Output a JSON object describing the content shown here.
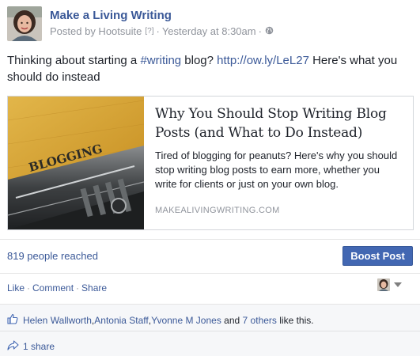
{
  "post": {
    "page_name": "Make a Living Writing",
    "posted_by": "Posted by Hootsuite",
    "help_marker": "[?]",
    "dot": "·",
    "timestamp": "Yesterday at 8:30am",
    "dot2": "·",
    "privacy_icon": "globe-icon",
    "text_before": "Thinking about starting a ",
    "hashtag": "#writing",
    "text_middle": " blog? ",
    "link": "http://ow.ly/LeL27",
    "text_after": " Here's what you should do instead"
  },
  "attachment": {
    "image_label": "BLOGGING",
    "title": "Why You Should Stop Writing Blog Posts (and What to Do Instead)",
    "description": "Tired of blogging for peanuts? Here's why you should stop writing blog posts to earn more, whether you write for clients or just on your own blog.",
    "domain": "MAKEALIVINGWRITING.COM"
  },
  "reach": {
    "label": "819 people reached",
    "boost_label": "Boost Post"
  },
  "actions": {
    "like": "Like",
    "comment": "Comment",
    "share": "Share",
    "sep": "·"
  },
  "likes": {
    "names": [
      "Helen Wallworth",
      "Antonia Staff",
      "Yvonne M Jones"
    ],
    "comma": ", ",
    "and_text": " and ",
    "others": "7 others",
    "suffix": " like this."
  },
  "shares": {
    "label": "1 share"
  },
  "colors": {
    "link_blue": "#3b5998",
    "boost_blue": "#4267b2",
    "meta_gray": "#90949c"
  }
}
